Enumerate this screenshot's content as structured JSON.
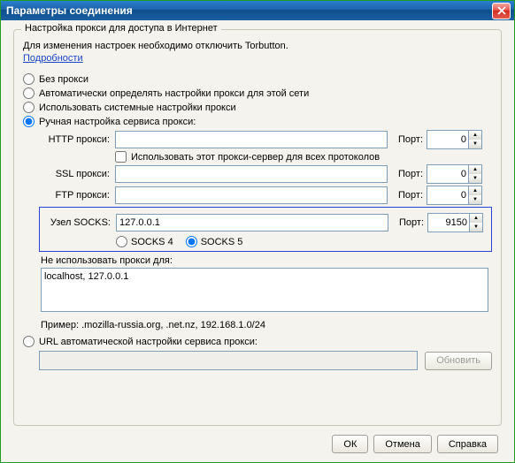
{
  "title": "Параметры соединения",
  "group_title": "Настройка прокси для доступа в Интернет",
  "info": "Для изменения настроек необходимо отключить Torbutton.",
  "details_link": "Подробности",
  "radios": {
    "none": "Без прокси",
    "auto": "Автоматически определять настройки прокси для этой сети",
    "system": "Использовать системные настройки прокси",
    "manual": "Ручная настройка сервиса прокси:"
  },
  "labels": {
    "http": "HTTP прокси:",
    "ssl": "SSL прокси:",
    "ftp": "FTP прокси:",
    "socks": "Узел SOCKS:",
    "port": "Порт:",
    "use_all": "Использовать этот прокси-сервер для всех протоколов",
    "socks4": "SOCKS 4",
    "socks5": "SOCKS 5",
    "no_proxy": "Не использовать прокси для:",
    "example": "Пример: .mozilla-russia.org, .net.nz, 192.168.1.0/24",
    "url_auto": "URL автоматической настройки сервиса прокси:"
  },
  "values": {
    "http": "",
    "http_port": "0",
    "ssl": "",
    "ssl_port": "0",
    "ftp": "",
    "ftp_port": "0",
    "socks": "127.0.0.1",
    "socks_port": "9150",
    "no_proxy": "localhost, 127.0.0.1",
    "url": ""
  },
  "buttons": {
    "reload": "Обновить",
    "ok": "ОК",
    "cancel": "Отмена",
    "help": "Справка"
  }
}
